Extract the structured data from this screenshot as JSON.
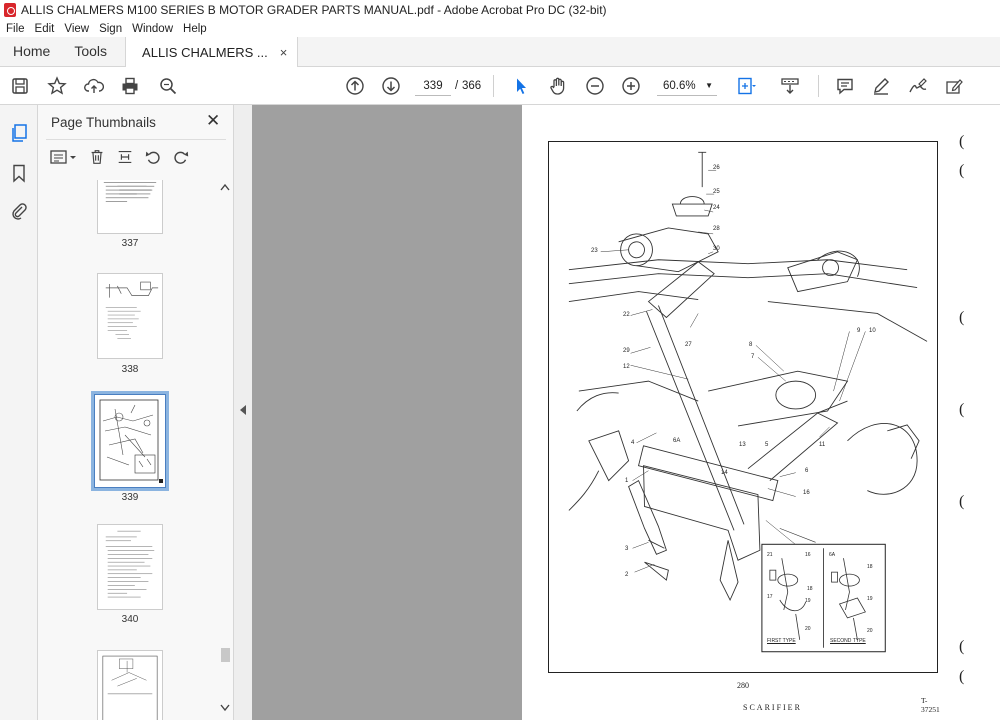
{
  "window": {
    "title": "ALLIS CHALMERS M100 SERIES B MOTOR GRADER PARTS MANUAL.pdf - Adobe Acrobat Pro DC (32-bit)"
  },
  "menu": [
    "File",
    "Edit",
    "View",
    "Sign",
    "Window",
    "Help"
  ],
  "tabs": {
    "home": "Home",
    "tools": "Tools",
    "document": "ALLIS CHALMERS ...",
    "close_glyph": "×"
  },
  "toolbar": {
    "current_page": "339",
    "page_separator": "/",
    "total_pages": "366",
    "zoom": "60.6%",
    "icons": [
      "save-icon",
      "bookmark-star-icon",
      "upload-cloud-icon",
      "print-icon",
      "zoom-search-icon",
      "page-up-icon",
      "page-down-icon",
      "select-arrow-icon",
      "hand-icon",
      "zoom-out-icon",
      "zoom-in-icon",
      "fit-page-icon",
      "scroll-mode-icon",
      "comment-icon",
      "highlight-pen-icon",
      "sign-icon",
      "fill-sign-icon"
    ]
  },
  "sidebar": {
    "title": "Page Thumbnails",
    "close_glyph": "✕",
    "thumbnails": [
      {
        "label": "337"
      },
      {
        "label": "338"
      },
      {
        "label": "339",
        "selected": true
      },
      {
        "label": "340"
      },
      {
        "label": ""
      }
    ]
  },
  "page": {
    "caption": "SCARIFIER",
    "page_number": "280",
    "figure_number": "T-37251",
    "inset_labels": {
      "first": "FIRST TYPE",
      "second": "SECOND TYPE"
    },
    "callouts": [
      "26",
      "25",
      "24",
      "28",
      "30",
      "23",
      "22",
      "27",
      "29",
      "12",
      "9",
      "10",
      "8",
      "7",
      "11",
      "4",
      "6A",
      "13",
      "5",
      "14",
      "6",
      "16",
      "1",
      "3",
      "2",
      "21",
      "6A",
      "16",
      "18",
      "19",
      "17",
      "18",
      "19",
      "20",
      "20"
    ],
    "margin_marks": [
      "(",
      "(",
      "(",
      "(",
      "(",
      "(",
      "("
    ]
  }
}
